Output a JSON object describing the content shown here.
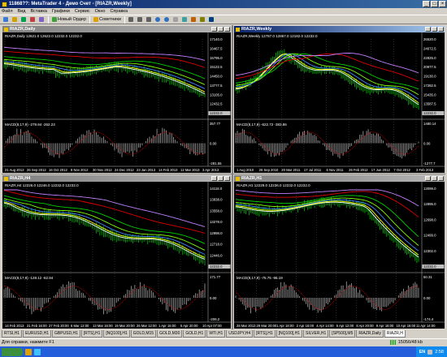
{
  "window": {
    "title": "11868??: MetaTrader 4 - Демо Счет - [RIAZR,Weekly]"
  },
  "menu": [
    "Файл",
    "Вид",
    "Вставка",
    "Графики",
    "Сервис",
    "Окно",
    "Справка"
  ],
  "toolbar": {
    "new_order_label": "Новый Ордер",
    "advisors_label": "Советники"
  },
  "charts": [
    {
      "id": "daily",
      "window_title": "RIAZR,Daily",
      "header": "RIAZR,Daily 12621.0 12622.0 12232.0 12232.0",
      "macd_label": "MACD(8,17,9) -279.94 -262.23",
      "price_labels": [
        "17140.0",
        "16467.5",
        "15795.0",
        "15122.5",
        "14450.0",
        "13777.5",
        "13105.0",
        "12432.5",
        "12232.0"
      ],
      "macd_scale": [
        "357.77",
        "0.00",
        "-281.55"
      ],
      "dates": [
        "21 Aug 2012",
        "26 Sep 2012",
        "16 Oct 2012",
        "8 Nov 2012",
        "30 Nov 2012",
        "24 Dec 2012",
        "23 Jan 2013",
        "14 Feb 2013",
        "12 Mar 2013",
        "3 Apr 2013"
      ],
      "active": false
    },
    {
      "id": "weekly",
      "window_title": "RIAZR,Weekly",
      "header": "RIAZR,Weekly 12787.0 12867.0 12182.0 12232.0",
      "macd_label": "MACD(8,17,9) -622.72 -383.86",
      "price_labels": [
        "26520.0",
        "24672.5",
        "22825.0",
        "20977.5",
        "19130.0",
        "17282.5",
        "15435.0",
        "13587.5",
        "12232.0"
      ],
      "macd_scale": [
        "1480.14",
        "0.00",
        "-1277.7"
      ],
      "dates": [
        "1 Aug 2010",
        "26 Sep 2010",
        "20 Mar 2011",
        "17 Jul 2011",
        "6 Nov 2011",
        "26 Feb 2012",
        "17 Jun 2012",
        "7 Oct 2012",
        "3 Feb 2013"
      ],
      "active": true
    },
    {
      "id": "h4",
      "window_title": "RIAZR,H4",
      "header": "RIAZR,H4 12226.0 12246.0 12232.0 12232.0",
      "macd_label": "MACD(8,17,9) -128.12 -62.94",
      "price_labels": [
        "14118.0",
        "13838.0",
        "13558.0",
        "13278.0",
        "12998.0",
        "12718.0",
        "12446.0",
        "12232.0"
      ],
      "macd_scale": [
        "171.77",
        "0.00",
        "-206.2"
      ],
      "dates": [
        "14 Feb 2013",
        "21 Feb 16:00",
        "27 Feb 20:00",
        "6 Mar 12:00",
        "13 Mar 16:00",
        "19 Mar 20:00",
        "26 Mar 12:00",
        "1 Apr 16:00",
        "5 Apr 20:00",
        "10 Apr 07:00"
      ],
      "active": false
    },
    {
      "id": "h1",
      "window_title": "RIAZR,H1",
      "header": "RIAZR,H1 12229.0 12236.0 12232.0 12232.0",
      "macd_label": "MACD(8,17,9) -75.75 -96.19",
      "price_labels": [
        "13099.0",
        "12895.0",
        "12698.0",
        "12499.0",
        "12302.0",
        "12232.0"
      ],
      "macd_scale": [
        "50.31",
        "0.00",
        "-174.4"
      ],
      "dates": [
        "28 Mar 2013",
        "29 Mar 20:00",
        "1 Apr 18:00",
        "2 Apr 16:00",
        "4 Apr 14:00",
        "5 Apr 12:00",
        "8 Apr 20:00",
        "9 Apr 18:00",
        "10 Apr 16:00",
        "11 Apr 14:00"
      ],
      "active": false
    }
  ],
  "tabs": [
    "RTSI,H1",
    "EURUSD,H1",
    "GBPUSD,H1",
    "[RTS],H1",
    "[NQ100],H1",
    "GOLD,M15",
    "GOLD,M30",
    "GOLD,H1",
    "WTI,H1",
    "USDJPY,H4",
    "[RTS],H1",
    "[NQ100],H1",
    "SILVER,H1",
    "[SP500],M5",
    "RIAZR,Daily",
    "RIAZR,H"
  ],
  "status": {
    "help_text": "Для справки, нажмите F1",
    "traffic": "15056/48 kb"
  },
  "tray": {
    "lang": "EN",
    "time": "2:58"
  },
  "colors": {
    "ma_red": "#e00000",
    "ma_violet": "#c080ff",
    "ma_green": "#00d000",
    "ma_lightgreen": "#80ff00",
    "ma_blue": "#4080ff",
    "ma_white": "#ffffff",
    "ma_yellow": "#ffff00",
    "price_bars": "#00c000",
    "macd_hist": "#c0c0c0",
    "macd_signal": "#ff0000"
  }
}
